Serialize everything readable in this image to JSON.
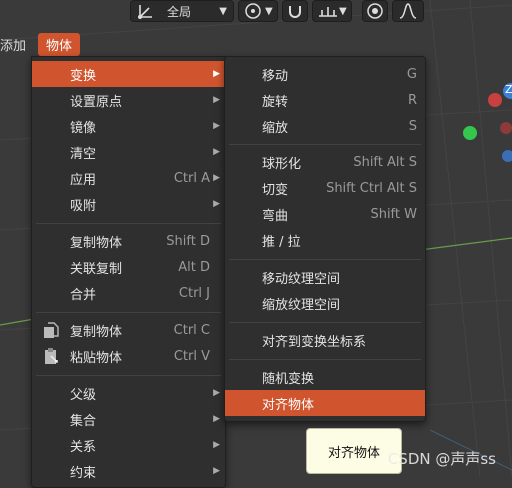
{
  "toolbar": {
    "orientation_label": "全局"
  },
  "menubar": {
    "add_label": "添加",
    "object_label": "物体"
  },
  "object_menu": {
    "items": [
      {
        "label": "变换",
        "shortcut": "",
        "submenu": true
      },
      {
        "label": "设置原点",
        "shortcut": "",
        "submenu": true
      },
      {
        "label": "镜像",
        "shortcut": "",
        "submenu": true
      },
      {
        "label": "清空",
        "shortcut": "",
        "submenu": true
      },
      {
        "label": "应用",
        "shortcut": "Ctrl A",
        "submenu": true
      },
      {
        "label": "吸附",
        "shortcut": "",
        "submenu": true
      },
      {
        "label": "复制物体",
        "shortcut": "Shift D",
        "submenu": false
      },
      {
        "label": "关联复制",
        "shortcut": "Alt D",
        "submenu": false
      },
      {
        "label": "合并",
        "shortcut": "Ctrl J",
        "submenu": false
      },
      {
        "label": "复制物体",
        "shortcut": "Ctrl C",
        "submenu": false
      },
      {
        "label": "粘贴物体",
        "shortcut": "Ctrl V",
        "submenu": false
      },
      {
        "label": "父级",
        "shortcut": "",
        "submenu": true
      },
      {
        "label": "集合",
        "shortcut": "",
        "submenu": true
      },
      {
        "label": "关系",
        "shortcut": "",
        "submenu": true
      },
      {
        "label": "约束",
        "shortcut": "",
        "submenu": true
      }
    ]
  },
  "transform_menu": {
    "items": [
      {
        "label": "移动",
        "shortcut": "G"
      },
      {
        "label": "旋转",
        "shortcut": "R"
      },
      {
        "label": "缩放",
        "shortcut": "S"
      },
      {
        "label": "球形化",
        "shortcut": "Shift Alt S"
      },
      {
        "label": "切变",
        "shortcut": "Shift Ctrl Alt S"
      },
      {
        "label": "弯曲",
        "shortcut": "Shift W"
      },
      {
        "label": "推 / 拉",
        "shortcut": ""
      },
      {
        "label": "移动纹理空间",
        "shortcut": ""
      },
      {
        "label": "缩放纹理空间",
        "shortcut": ""
      },
      {
        "label": "对齐到变换坐标系",
        "shortcut": ""
      },
      {
        "label": "随机变换",
        "shortcut": ""
      },
      {
        "label": "对齐物体",
        "shortcut": ""
      }
    ]
  },
  "gizmo": {
    "z_label": "Z"
  },
  "tooltip": {
    "text": "对齐物体"
  },
  "watermark": {
    "text": "CSDN @声声ss"
  },
  "colors": {
    "accent": "#d0552e",
    "menu_bg": "#2f2f2f",
    "viewport_bg": "#3a3a3a",
    "tooltip_bg": "#fdfde6"
  }
}
